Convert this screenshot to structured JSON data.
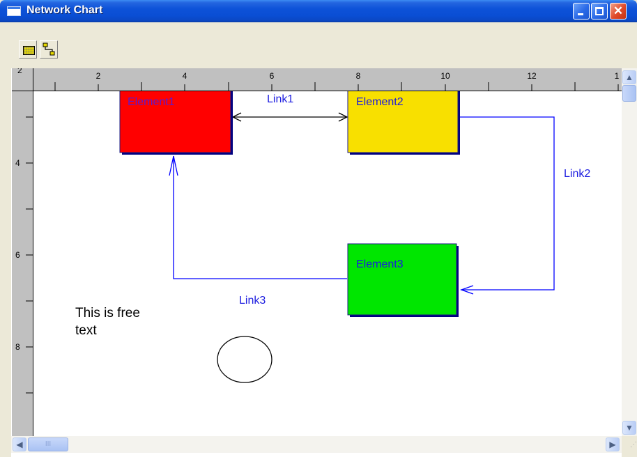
{
  "window": {
    "title": "Network Chart"
  },
  "toolbar": {
    "buttons": [
      "rectangle-tool-icon",
      "link-tool-icon"
    ]
  },
  "rulers": {
    "horizontal_labels": [
      "2",
      "4",
      "6",
      "8",
      "10",
      "12",
      "1"
    ],
    "vertical_labels": [
      "4",
      "6",
      "8"
    ],
    "corner_label": "2"
  },
  "diagram": {
    "elements": [
      {
        "label": "Element1",
        "fill": "#ff0000",
        "text_color": "#5a1ad0"
      },
      {
        "label": "Element2",
        "fill": "#f8e000",
        "text_color": "#1a1ae0"
      },
      {
        "label": "Element3",
        "fill": "#00e600",
        "text_color": "#1a1ae0"
      }
    ],
    "links": [
      {
        "label": "Link1",
        "from": "Element1",
        "to": "Element2",
        "arrows": "both"
      },
      {
        "label": "Link2",
        "from": "Element2",
        "to": "Element3",
        "arrows": "end"
      },
      {
        "label": "Link3",
        "from": "Element3",
        "to": "Element1",
        "arrows": "end"
      }
    ],
    "free_text": [
      "This is free",
      "text"
    ],
    "shapes": [
      "ellipse"
    ]
  },
  "colors": {
    "link": "#0000ff",
    "link_label": "#1e1ee0",
    "titlebar": "#0a4ed4"
  },
  "scrollbars": {
    "thumb_grip": "III"
  }
}
